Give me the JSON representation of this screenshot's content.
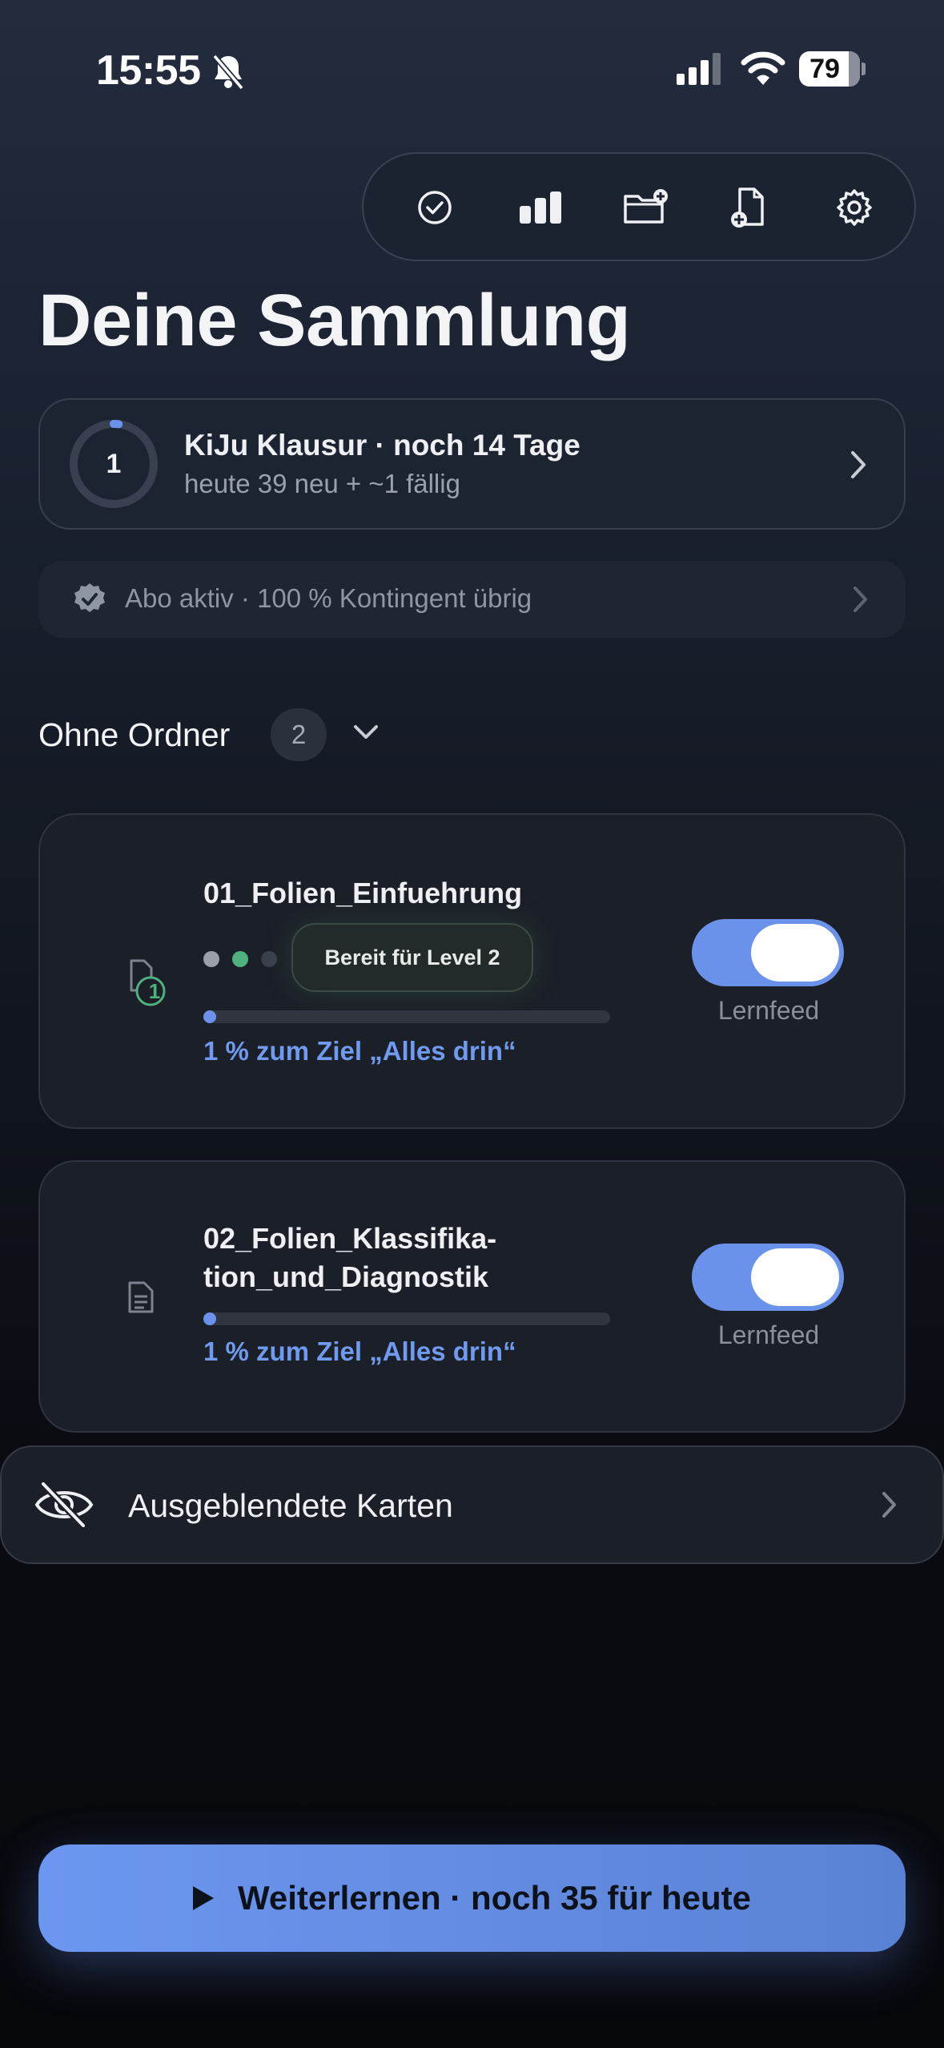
{
  "status_bar": {
    "time": "15:55",
    "battery": "79",
    "icons": [
      "bell-slash-icon",
      "cellular-signal-icon",
      "wifi-icon",
      "battery-icon"
    ]
  },
  "toolbar": {
    "icons": [
      "check-circle-icon",
      "bar-chart-icon",
      "folder-add-icon",
      "file-add-icon",
      "gear-icon"
    ]
  },
  "header": {
    "title": "Deine Sammlung"
  },
  "exam": {
    "ring_number": "1",
    "title": "KiJu Klausur · noch 14 Tage",
    "subtitle": "heute 39 neu + ~1 fällig",
    "ring_progress": 0.02
  },
  "subscription": {
    "text": "Abo aktiv · 100 % Kontingent übrig"
  },
  "section": {
    "title": "Ohne Ordner",
    "count": "2"
  },
  "documents": [
    {
      "name": "01_Folien_Einfuehrung",
      "badge": "1",
      "level_chip": "Bereit für Level 2",
      "progress": 0.01,
      "progress_label": "1 % zum Ziel „Alles drin“",
      "toggle_label": "Lernfeed",
      "toggle_on": true
    },
    {
      "name_line1": "02_Folien_Klassifika-",
      "name_line2": "tion_und_Diagnostik",
      "progress": 0.01,
      "progress_label": "1 % zum Ziel „Alles drin“",
      "toggle_label": "Lernfeed",
      "toggle_on": true
    }
  ],
  "hidden_cards": {
    "label": "Ausgeblendete Karten"
  },
  "cta": {
    "label": "Weiterlernen · noch 35 für heute"
  },
  "colors": {
    "accent": "#6b92ea",
    "success": "#4fb27e",
    "muted": "#8f96a3"
  }
}
